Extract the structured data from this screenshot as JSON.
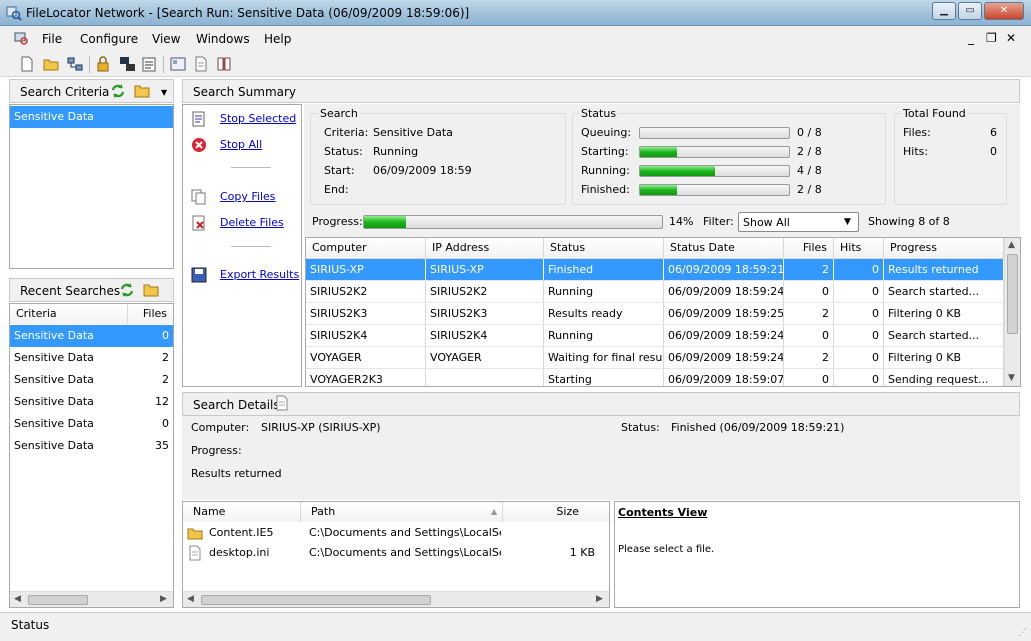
{
  "window": {
    "title": "FileLocator Network - [Search Run: Sensitive Data (06/09/2009 18:59:06)]"
  },
  "menu": {
    "file": "File",
    "configure": "Configure",
    "view": "View",
    "windows": "Windows",
    "help": "Help"
  },
  "search_criteria": {
    "title": "Search Criteria",
    "items": [
      "Sensitive Data"
    ]
  },
  "recent": {
    "title": "Recent Searches",
    "col_criteria": "Criteria",
    "col_files": "Files",
    "rows": [
      {
        "c": "Sensitive Data",
        "f": "0"
      },
      {
        "c": "Sensitive Data",
        "f": "2"
      },
      {
        "c": "Sensitive Data",
        "f": "2"
      },
      {
        "c": "Sensitive Data",
        "f": "12"
      },
      {
        "c": "Sensitive Data",
        "f": "0"
      },
      {
        "c": "Sensitive Data",
        "f": "35"
      }
    ]
  },
  "summary": {
    "title": "Search Summary",
    "actions": {
      "stop_selected": "Stop Selected",
      "stop_all": "Stop All",
      "copy_files": "Copy Files",
      "delete_files": "Delete Files",
      "export_results": "Export Results"
    },
    "search": {
      "group": "Search",
      "criteria_label": "Criteria:",
      "criteria": "Sensitive Data",
      "status_label": "Status:",
      "status": "Running",
      "start_label": "Start:",
      "start": "06/09/2009 18:59",
      "end_label": "End:",
      "end": ""
    },
    "status": {
      "group": "Status",
      "queuing_label": "Queuing:",
      "queuing": "0 / 8",
      "starting_label": "Starting:",
      "starting": "2 / 8",
      "running_label": "Running:",
      "running": "4 / 8",
      "finished_label": "Finished:",
      "finished": "2 / 8",
      "fractions": {
        "queuing": 0,
        "starting": 0.25,
        "running": 0.5,
        "finished": 0.25
      }
    },
    "total": {
      "group": "Total Found",
      "files_label": "Files:",
      "files": "6",
      "hits_label": "Hits:",
      "hits": "0"
    },
    "progress": {
      "label": "Progress:",
      "value": 0.14,
      "text": "14%",
      "filter_label": "Filter:",
      "filter": "Show All",
      "showing": "Showing 8 of 8"
    }
  },
  "results": {
    "cols": [
      "Computer",
      "IP Address",
      "Status",
      "Status Date",
      "Files",
      "Hits",
      "Progress"
    ],
    "rows": [
      [
        "SIRIUS-XP",
        "SIRIUS-XP",
        "Finished",
        "06/09/2009 18:59:21",
        "2",
        "0",
        "Results returned"
      ],
      [
        "SIRIUS2K2",
        "SIRIUS2K2",
        "Running",
        "06/09/2009 18:59:24",
        "0",
        "0",
        "Search started..."
      ],
      [
        "SIRIUS2K3",
        "SIRIUS2K3",
        "Results ready",
        "06/09/2009 18:59:25",
        "2",
        "0",
        "Filtering 0 KB"
      ],
      [
        "SIRIUS2K4",
        "SIRIUS2K4",
        "Running",
        "06/09/2009 18:59:24",
        "0",
        "0",
        "Search started..."
      ],
      [
        "VOYAGER",
        "VOYAGER",
        "Waiting for final result",
        "06/09/2009 18:59:24",
        "2",
        "0",
        "Filtering 0 KB"
      ],
      [
        "VOYAGER2K3",
        "",
        "Starting",
        "06/09/2009 18:59:07",
        "0",
        "0",
        "Sending request..."
      ]
    ]
  },
  "details": {
    "title": "Search Details",
    "computer_label": "Computer:",
    "computer": "SIRIUS-XP (SIRIUS-XP)",
    "status_label": "Status:",
    "status": "Finished (06/09/2009 18:59:21)",
    "progress_label": "Progress:",
    "message": "Results returned"
  },
  "files": {
    "cols": [
      "Name",
      "Path",
      "Size"
    ],
    "rows": [
      {
        "name": "Content.IE5",
        "path": "C:\\Documents and Settings\\LocalServ...",
        "size": ""
      },
      {
        "name": "desktop.ini",
        "path": "C:\\Documents and Settings\\LocalServ...",
        "size": "1 KB"
      }
    ]
  },
  "contents": {
    "title": "Contents View",
    "message": "Please select a file."
  },
  "statusbar": {
    "text": "Status"
  },
  "colors": {
    "selection": "#3399ff",
    "progress_green": "#1fb41f",
    "link": "#0000cc"
  }
}
